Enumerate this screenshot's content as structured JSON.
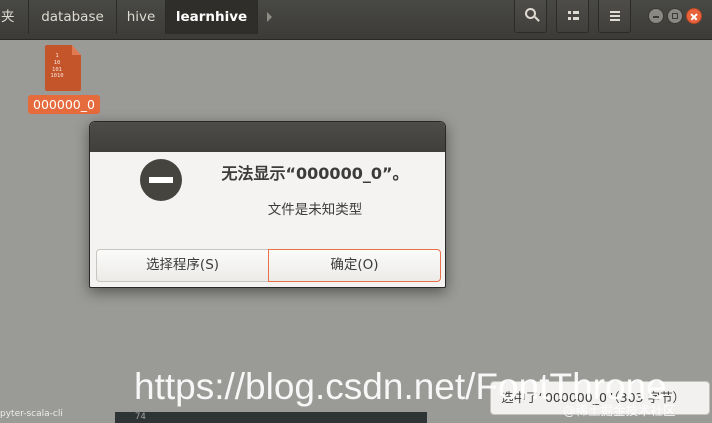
{
  "headerbar": {
    "breadcrumbs": [
      "夹",
      "database",
      "hive",
      "learnhive"
    ]
  },
  "desktop": {
    "file": {
      "name": "000000_0",
      "icon": "binary-file-icon",
      "glyph_lines": [
        "1",
        "10",
        "101",
        "1010"
      ]
    }
  },
  "dialog": {
    "title": "无法显示“000000_0”。",
    "subtitle": "文件是未知类型",
    "icon": "error-icon",
    "buttons": {
      "choose": "选择程序(S)",
      "ok": "确定(O)"
    }
  },
  "statusbar": {
    "text": "选中了“000000_0”（303 字节）"
  },
  "background": {
    "left_fragment": "pyter-scala-cli",
    "terminal_number": "74"
  },
  "watermark": {
    "url": "https://blog.csdn.net/FontThrone",
    "community": "@稀土掘金技术社区"
  },
  "colors": {
    "accent": "#e56a3c",
    "headerbar": "#3c3b37",
    "close_button": "#e9633b"
  }
}
